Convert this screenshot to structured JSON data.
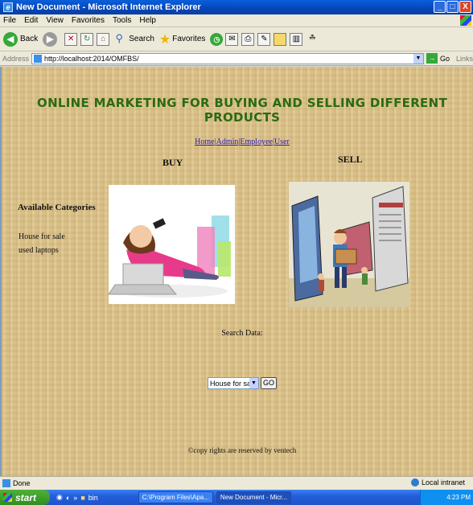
{
  "window": {
    "title": "New Document - Microsoft Internet Explorer",
    "buttons": {
      "minimize": "_",
      "maximize": "□",
      "close": "X"
    }
  },
  "menu": [
    "File",
    "Edit",
    "View",
    "Favorites",
    "Tools",
    "Help"
  ],
  "toolbar": {
    "back_label": "Back",
    "search_label": "Search",
    "favorites_label": "Favorites"
  },
  "address": {
    "label": "Address",
    "url": "http://localhost:2014/OMFBS/",
    "go_label": "Go",
    "links_label": "Links"
  },
  "page": {
    "heading": "ONLINE MARKETING FOR BUYING AND SELLING DIFFERENT PRODUCTS",
    "nav": [
      "Home",
      "Admin",
      "Employee",
      "User"
    ],
    "nav_separator": "|",
    "buy_title": "BUY",
    "sell_title": "SELL",
    "categories_title": "Available Categories",
    "categories": [
      "House for sale",
      "used laptops"
    ],
    "search_label": "Search Data:",
    "search_selected": "House for sale",
    "search_go": "GO",
    "footer": "©copy rights are reserved by ventech"
  },
  "status": {
    "text": "Done",
    "zone": "Local intranet"
  },
  "taskbar": {
    "start": "start",
    "quick_label": "bin",
    "tasks": [
      "C:\\Program Files\\Apa...",
      "New Document - Micr..."
    ],
    "clock": "4:23 PM"
  }
}
